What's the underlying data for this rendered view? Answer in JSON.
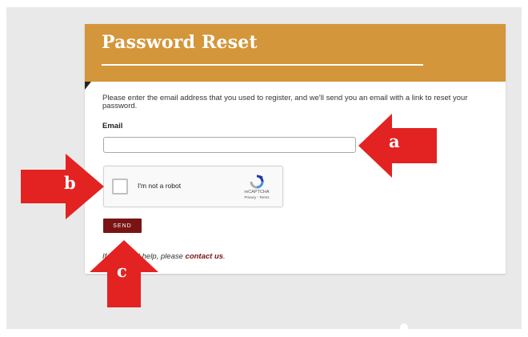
{
  "page": {
    "title": "Password Reset",
    "instructions": "Please enter the email address that you used to register, and we'll send you an email with a link to reset your password.",
    "email_label": "Email",
    "email_value": "",
    "captcha": {
      "label": "I'm not a robot",
      "brand": "reCAPTCHA",
      "links": "Privacy - Terms",
      "checked": false
    },
    "send_label": "SEND",
    "help_prefix": "If you need help, please ",
    "help_link": "contact us",
    "help_suffix": "."
  },
  "annotations": {
    "a": "a",
    "b": "b",
    "c": "c"
  },
  "colors": {
    "header": "#d4963a",
    "send_button": "#7a1414",
    "arrow": "#e32222"
  }
}
